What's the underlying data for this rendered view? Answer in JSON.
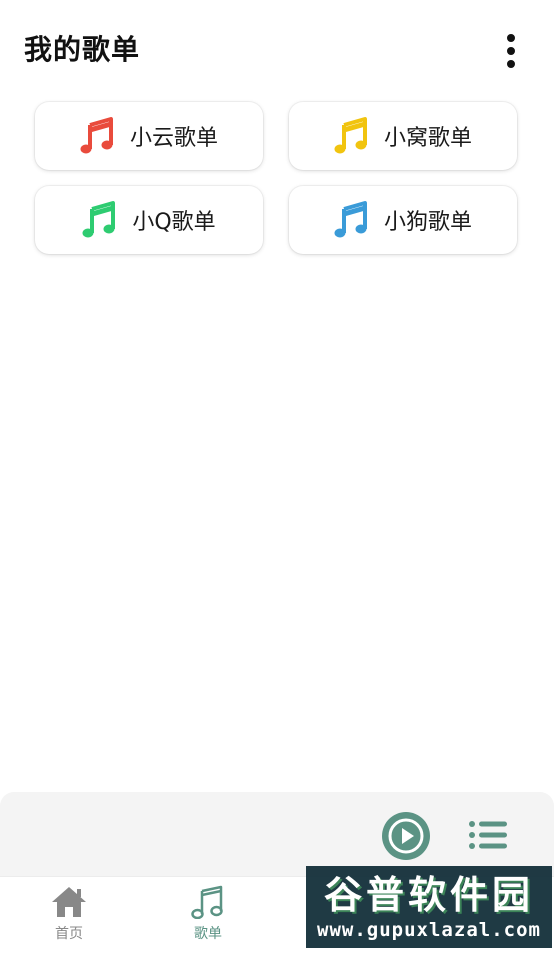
{
  "header": {
    "title": "我的歌单"
  },
  "playlists": [
    {
      "label": "小云歌单",
      "color": "#e94b3c"
    },
    {
      "label": "小窝歌单",
      "color": "#f1c40f"
    },
    {
      "label": "小Q歌单",
      "color": "#2ecc71"
    },
    {
      "label": "小狗歌单",
      "color": "#3a9bd8"
    }
  ],
  "player": {
    "accent": "#5b9384"
  },
  "tabbar": {
    "home_label": "首页",
    "playlist_label": "歌单",
    "inactive_color": "#888888",
    "active_color": "#5b9384"
  },
  "watermark": {
    "title": "谷普软件园",
    "url": "www.gupuxlazal.com"
  }
}
